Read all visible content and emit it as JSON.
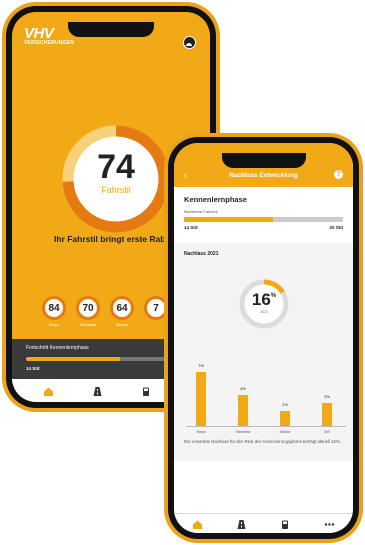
{
  "phone1": {
    "logo_big": "VHV",
    "logo_small": "VERSICHERUNGEN",
    "score": "74",
    "score_label": "Fahrstil",
    "score_fraction": 0.74,
    "message": "Ihr Fahrstil bringt erste Rabatt",
    "minis": [
      {
        "value": "84",
        "label": "Tempo"
      },
      {
        "value": "70",
        "label": "Fahrweise"
      },
      {
        "value": "64",
        "label": "Strecke"
      },
      {
        "value": "7",
        "label": ""
      }
    ],
    "phase_title": "Fortschritt Kennenlernphase",
    "phase_value": "14 Std",
    "phase_fraction": 0.55,
    "tabs": [
      "home-icon",
      "road-icon",
      "fuel-icon"
    ]
  },
  "phone2": {
    "header_title": "Nachlass Entwicklung",
    "help_glyph": "?",
    "back_glyph": "‹",
    "kp_title": "Kennenlernphase",
    "kp_sub": "Bewertete Fahrzeit",
    "kp_start": "14 Std",
    "kp_end": "20 Std",
    "kp_fraction": 0.56,
    "nachlass_label": "Nachlass 2021",
    "ring_value": "16",
    "ring_unit": "%",
    "ring_year": "2021",
    "ring_fraction": 0.16,
    "note": "Der erwartete Nachlass für den Rest des Versicherungsjahres beträgt aktuell 16%.",
    "tabs": [
      "home-icon",
      "road-icon",
      "fuel-icon",
      "more-icon"
    ]
  },
  "chart_data": {
    "type": "bar",
    "categories": [
      "Tempo",
      "Fahrweise",
      "Strecke",
      "Zeit"
    ],
    "values": [
      7,
      4,
      2,
      3
    ],
    "value_labels": [
      "7%",
      "4%",
      "2%",
      "3%"
    ],
    "ylim": [
      0,
      8
    ]
  },
  "colors": {
    "accent": "#f2a916",
    "dark": "#222222",
    "ring_orange": "#e57a12"
  }
}
